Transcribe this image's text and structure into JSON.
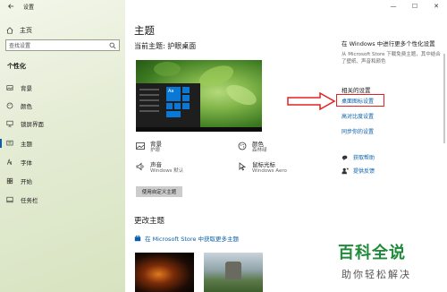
{
  "window": {
    "title": "设置",
    "minimize": "—",
    "maximize": "☐",
    "close": "✕"
  },
  "sidebar": {
    "home_label": "主页",
    "search_placeholder": "查找设置",
    "section_label": "个性化",
    "items": [
      {
        "label": "背景",
        "icon": "image-icon"
      },
      {
        "label": "颜色",
        "icon": "palette-icon"
      },
      {
        "label": "锁屏界面",
        "icon": "monitor-icon"
      },
      {
        "label": "主题",
        "icon": "brush-icon",
        "active": true
      },
      {
        "label": "字体",
        "icon": "font-icon"
      },
      {
        "label": "开始",
        "icon": "start-icon"
      },
      {
        "label": "任务栏",
        "icon": "taskbar-icon"
      }
    ]
  },
  "main": {
    "page_title": "主题",
    "current_theme": "当前主题: 护眼桌面",
    "preview_tile_label": "Aa",
    "props": {
      "background": {
        "title": "背景",
        "value": "护眼"
      },
      "color": {
        "title": "颜色",
        "value": "森林绿"
      },
      "sound": {
        "title": "声音",
        "value": "Windows 默认"
      },
      "cursor": {
        "title": "鼠标光标",
        "value": "Windows Aero"
      }
    },
    "save_button": "使用自定义主题",
    "change_theme_title": "更改主题",
    "store_link": "在 Microsoft Store 中获取更多主题"
  },
  "right": {
    "heading": "在 Windows 中进行更多个性化设置",
    "description": "从 Microsoft Store 下载免费主题，其中结合了壁纸、声音和颜色",
    "related_heading": "相关的设置",
    "links": [
      "桌面图标设置",
      "高对比度设置",
      "同步你的设置"
    ],
    "help": [
      "获取帮助",
      "提供反馈"
    ]
  },
  "watermark": {
    "big": "百科全说",
    "small": "助你轻松解决"
  },
  "colors": {
    "accent": "#0a5fa8",
    "highlight": "#e42020",
    "sidebar": "#e4ecd4",
    "tile": "#0a78d7"
  }
}
